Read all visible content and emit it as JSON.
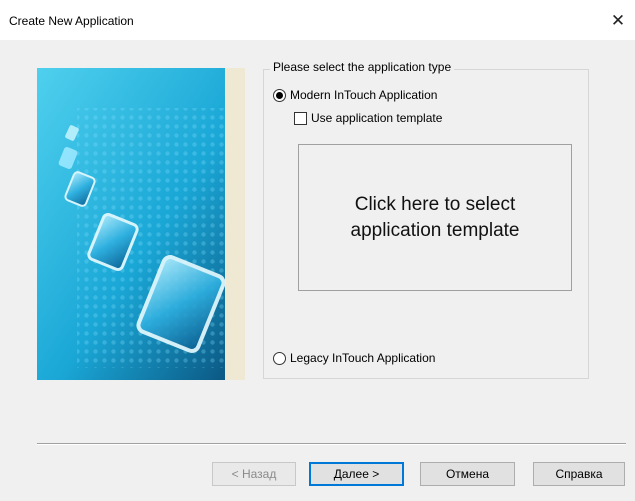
{
  "window": {
    "title": "Create New Application",
    "close_icon": "close-icon"
  },
  "group": {
    "legend": "Please select the application type",
    "options": {
      "modern": {
        "label": "Modern InTouch Application",
        "selected": true
      },
      "use_template": {
        "label": "Use application template",
        "checked": false
      },
      "legacy": {
        "label": "Legacy InTouch Application",
        "selected": false
      }
    },
    "template_box": {
      "text": "Click here to select\napplication template"
    }
  },
  "buttons": {
    "back": "< Назад",
    "next": "Далее >",
    "cancel": "Отмена",
    "help": "Справка"
  },
  "colors": {
    "banner_cyan": "#2ab6dd",
    "banner_deep": "#0a4f7a",
    "accent_blue": "#0078d7"
  }
}
